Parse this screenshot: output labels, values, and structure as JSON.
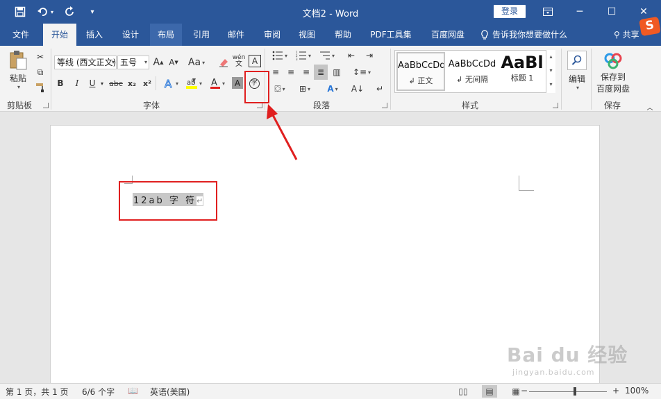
{
  "window": {
    "title": "文档2 - Word",
    "login": "登录",
    "ribbon_options_icon": "ribbon-display-icon",
    "minimize": "─",
    "maximize": "☐",
    "close": "✕"
  },
  "qat": {
    "save": "💾",
    "undo": "↶",
    "redo": "↻",
    "customize": "⌄"
  },
  "tabs": [
    {
      "label": "文件"
    },
    {
      "label": "开始"
    },
    {
      "label": "插入"
    },
    {
      "label": "设计"
    },
    {
      "label": "布局"
    },
    {
      "label": "引用"
    },
    {
      "label": "邮件"
    },
    {
      "label": "审阅"
    },
    {
      "label": "视图"
    },
    {
      "label": "帮助"
    },
    {
      "label": "PDF工具集"
    },
    {
      "label": "百度网盘"
    }
  ],
  "tellme": "告诉我你想要做什么",
  "share": "共享",
  "sogou": "S",
  "ribbon": {
    "clipboard": {
      "label": "剪贴板",
      "paste": "粘贴"
    },
    "font": {
      "label": "字体",
      "font_name": "等线 (西文正文)",
      "font_size": "五号",
      "bold": "B",
      "italic": "I",
      "underline": "U",
      "strike": "abc",
      "sub": "x₂",
      "sup": "x²",
      "grow": "A",
      "shrink": "A",
      "case": "Aa",
      "phonetic": "wén",
      "border_char": "A",
      "enclose_char": "字"
    },
    "paragraph": {
      "label": "段落"
    },
    "styles": {
      "label": "样式",
      "items": [
        {
          "sample": "AaBbCcDd",
          "name": "↲ 正文"
        },
        {
          "sample": "AaBbCcDd",
          "name": "↲ 无间隔"
        },
        {
          "sample": "AaBl",
          "name": "标题 1"
        }
      ]
    },
    "editing": {
      "label": "编辑"
    },
    "save": {
      "label": "保存",
      "button": "保存到百度网盘",
      "line1": "保存到",
      "line2": "百度网盘"
    }
  },
  "document": {
    "text": "12ab 字 符",
    "pilcrow": "↵"
  },
  "watermark": {
    "main": "Bai du 经验",
    "sub": "jingyan.baidu.com"
  },
  "status": {
    "page": "第 1 页，共 1 页",
    "words": "6/6 个字",
    "lang": "英语(美国)",
    "zoom_minus": "−",
    "zoom_plus": "+",
    "zoom": "100%"
  },
  "colors": {
    "accent": "#2b579a",
    "highlight_red": "#e01f1f",
    "sogou": "#f05a23"
  }
}
